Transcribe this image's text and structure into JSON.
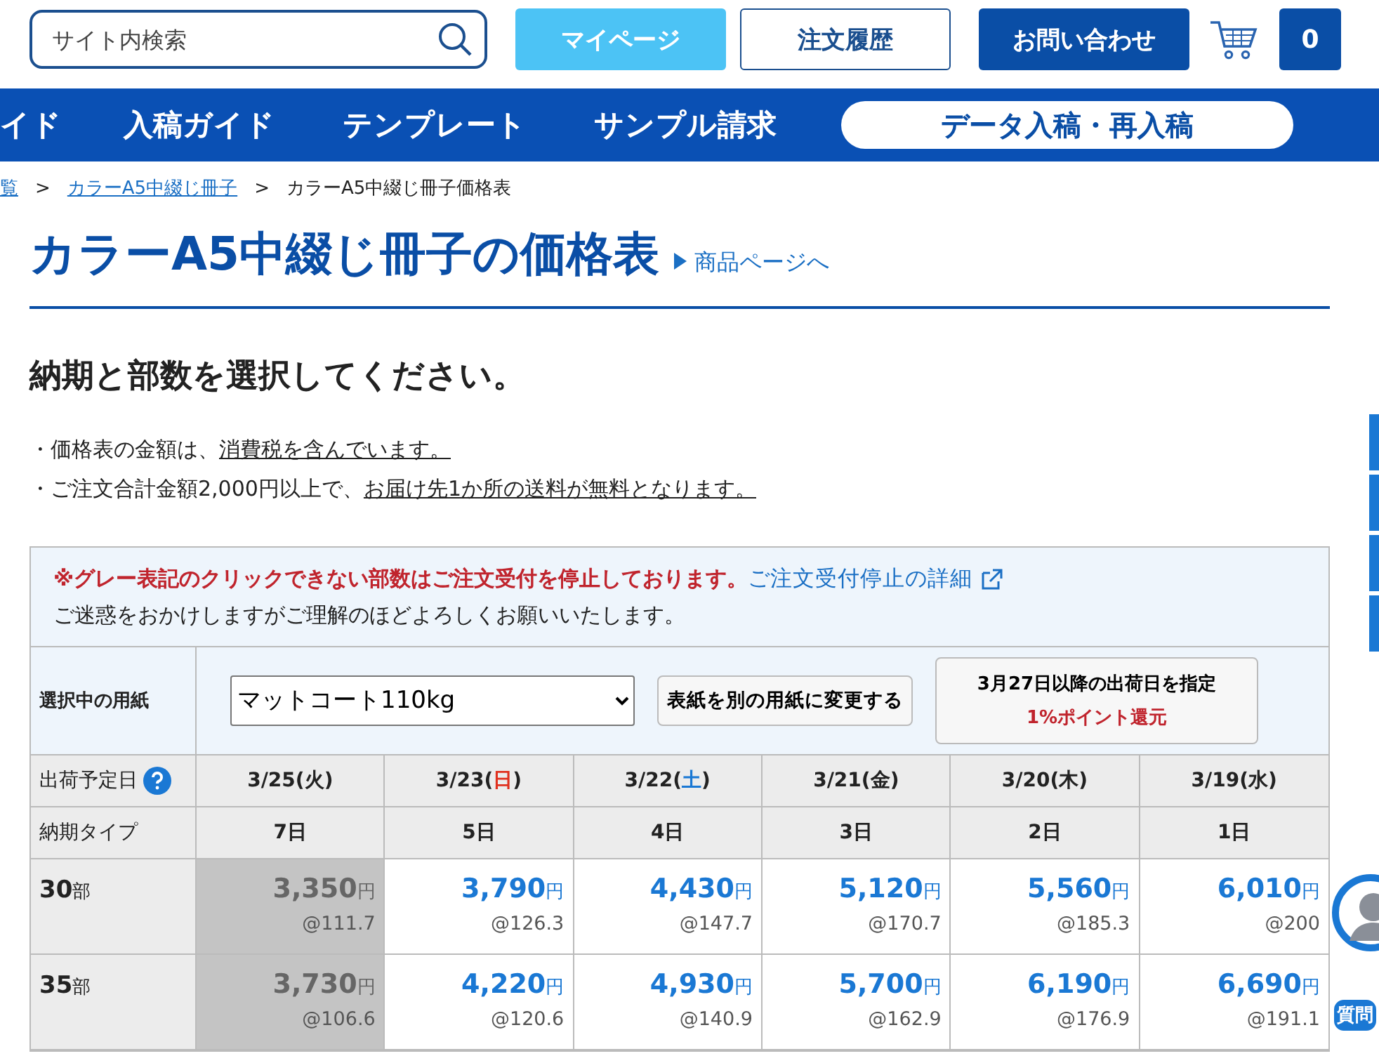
{
  "header": {
    "search": {
      "placeholder": "サイト内検索"
    },
    "buttons": [
      {
        "label": "マイページ",
        "kind": "light"
      },
      {
        "label": "注文履歴",
        "kind": "outline"
      },
      {
        "label": "お問い合わせ",
        "kind": "dark"
      }
    ],
    "cart": {
      "count": "0"
    }
  },
  "nav": {
    "items": [
      {
        "label": "イド",
        "kind": "link"
      },
      {
        "label": "入稿ガイド",
        "kind": "link"
      },
      {
        "label": "テンプレート",
        "kind": "link"
      },
      {
        "label": "サンプル請求",
        "kind": "link"
      },
      {
        "label": "データ入稿・再入稿",
        "kind": "pill"
      }
    ]
  },
  "breadcrumb": [
    {
      "label": "覧",
      "link": true
    },
    {
      "label": ">",
      "link": false
    },
    {
      "label": "カラーA5中綴じ冊子",
      "link": true
    },
    {
      "label": ">",
      "link": false
    },
    {
      "label": "カラーA5中綴じ冊子価格表",
      "link": false
    }
  ],
  "title": "カラーA5中綴じ冊子の価格表",
  "product_link": "商品ページへ",
  "section_heading": "納期と部数を選択してください。",
  "notes": [
    {
      "bullet": "・",
      "text": "価格表の金額は、",
      "link": "消費税を含んでいます。"
    },
    {
      "bullet": "・",
      "text": "ご注文合計金額2,000円以上で、",
      "link": "お届け先1か所の送料が無料となります。"
    }
  ],
  "notice": {
    "warning": "※グレー表記のクリックできない部数はご注文受付を停止しております。",
    "link": "ご注文受付停止の詳細",
    "message": "ご迷惑をおかけしますがご理解のほどよろしくお願いいたします。"
  },
  "paper": {
    "label": "選択中の用紙",
    "value": "マットコート110kg",
    "change_button": "表紙を別の用紙に変更する",
    "date_button": {
      "line1": "3月27日以降の出荷日を指定",
      "line2": "1%ポイント還元"
    }
  },
  "table": {
    "date_label": "出荷予定日",
    "type_label": "納期タイプ",
    "columns": [
      {
        "prefix": "3/25(",
        "weekday": "火",
        "suffix": ")",
        "color": "#222222",
        "type": "7日"
      },
      {
        "prefix": "3/23(",
        "weekday": "日",
        "suffix": ")",
        "color": "#e0301e",
        "type": "5日"
      },
      {
        "prefix": "3/22(",
        "weekday": "土",
        "suffix": ")",
        "color": "#1a78d4",
        "type": "4日"
      },
      {
        "prefix": "3/21(",
        "weekday": "金",
        "suffix": ")",
        "color": "#222222",
        "type": "3日"
      },
      {
        "prefix": "3/20(",
        "weekday": "木",
        "suffix": ")",
        "color": "#222222",
        "type": "2日"
      },
      {
        "prefix": "3/19(",
        "weekday": "水",
        "suffix": ")",
        "color": "#222222",
        "type": "1日"
      }
    ],
    "rows": [
      {
        "qty": "30",
        "unit": "部",
        "cells": [
          {
            "price": "3,350",
            "yen": "円",
            "each": "@111.7",
            "disabled": true
          },
          {
            "price": "3,790",
            "yen": "円",
            "each": "@126.3",
            "disabled": false
          },
          {
            "price": "4,430",
            "yen": "円",
            "each": "@147.7",
            "disabled": false
          },
          {
            "price": "5,120",
            "yen": "円",
            "each": "@170.7",
            "disabled": false
          },
          {
            "price": "5,560",
            "yen": "円",
            "each": "@185.3",
            "disabled": false
          },
          {
            "price": "6,010",
            "yen": "円",
            "each": "@200",
            "disabled": false
          }
        ]
      },
      {
        "qty": "35",
        "unit": "部",
        "cells": [
          {
            "price": "3,730",
            "yen": "円",
            "each": "@106.6",
            "disabled": true
          },
          {
            "price": "4,220",
            "yen": "円",
            "each": "@120.6",
            "disabled": false
          },
          {
            "price": "4,930",
            "yen": "円",
            "each": "@140.9",
            "disabled": false
          },
          {
            "price": "5,700",
            "yen": "円",
            "each": "@162.9",
            "disabled": false
          },
          {
            "price": "6,190",
            "yen": "円",
            "each": "@176.9",
            "disabled": false
          },
          {
            "price": "6,690",
            "yen": "円",
            "each": "@191.1",
            "disabled": false
          }
        ]
      }
    ]
  },
  "chat": {
    "label": "質問"
  }
}
